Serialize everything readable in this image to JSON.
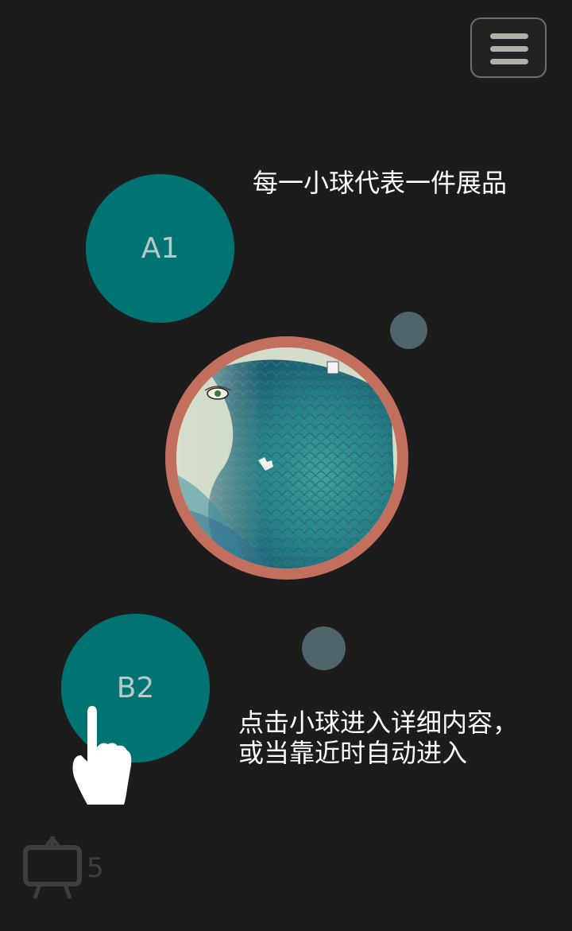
{
  "menu": {
    "icon": "hamburger-menu-icon"
  },
  "balls": {
    "a1": {
      "label": "A1"
    },
    "b2": {
      "label": "B2"
    }
  },
  "hints": {
    "top": "每一小球代表一件展品",
    "bottom_line1": "点击小球进入详细内容，",
    "bottom_line2": "或当靠近时自动进入"
  },
  "featured": {
    "icon": "artwork-fish-scale-image"
  },
  "gesture": {
    "icon": "tap-hand-icon"
  },
  "exhibit_count": {
    "icon": "easel-icon",
    "value": "5"
  },
  "colors": {
    "background": "#1c1c1c",
    "ball": "#007473",
    "ball_text": "#b6c9c8",
    "small_dot": "#4f6569",
    "featured_ring": "#c2705d",
    "menu_border": "#6e6e6e",
    "count": "#3e3e3e"
  }
}
